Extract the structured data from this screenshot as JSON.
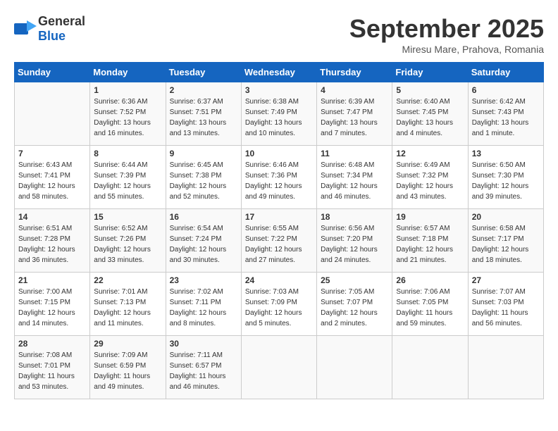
{
  "logo": {
    "general": "General",
    "blue": "Blue"
  },
  "title": "September 2025",
  "location": "Miresu Mare, Prahova, Romania",
  "days_of_week": [
    "Sunday",
    "Monday",
    "Tuesday",
    "Wednesday",
    "Thursday",
    "Friday",
    "Saturday"
  ],
  "weeks": [
    [
      {
        "day": "",
        "info": ""
      },
      {
        "day": "1",
        "info": "Sunrise: 6:36 AM\nSunset: 7:52 PM\nDaylight: 13 hours\nand 16 minutes."
      },
      {
        "day": "2",
        "info": "Sunrise: 6:37 AM\nSunset: 7:51 PM\nDaylight: 13 hours\nand 13 minutes."
      },
      {
        "day": "3",
        "info": "Sunrise: 6:38 AM\nSunset: 7:49 PM\nDaylight: 13 hours\nand 10 minutes."
      },
      {
        "day": "4",
        "info": "Sunrise: 6:39 AM\nSunset: 7:47 PM\nDaylight: 13 hours\nand 7 minutes."
      },
      {
        "day": "5",
        "info": "Sunrise: 6:40 AM\nSunset: 7:45 PM\nDaylight: 13 hours\nand 4 minutes."
      },
      {
        "day": "6",
        "info": "Sunrise: 6:42 AM\nSunset: 7:43 PM\nDaylight: 13 hours\nand 1 minute."
      }
    ],
    [
      {
        "day": "7",
        "info": "Sunrise: 6:43 AM\nSunset: 7:41 PM\nDaylight: 12 hours\nand 58 minutes."
      },
      {
        "day": "8",
        "info": "Sunrise: 6:44 AM\nSunset: 7:39 PM\nDaylight: 12 hours\nand 55 minutes."
      },
      {
        "day": "9",
        "info": "Sunrise: 6:45 AM\nSunset: 7:38 PM\nDaylight: 12 hours\nand 52 minutes."
      },
      {
        "day": "10",
        "info": "Sunrise: 6:46 AM\nSunset: 7:36 PM\nDaylight: 12 hours\nand 49 minutes."
      },
      {
        "day": "11",
        "info": "Sunrise: 6:48 AM\nSunset: 7:34 PM\nDaylight: 12 hours\nand 46 minutes."
      },
      {
        "day": "12",
        "info": "Sunrise: 6:49 AM\nSunset: 7:32 PM\nDaylight: 12 hours\nand 43 minutes."
      },
      {
        "day": "13",
        "info": "Sunrise: 6:50 AM\nSunset: 7:30 PM\nDaylight: 12 hours\nand 39 minutes."
      }
    ],
    [
      {
        "day": "14",
        "info": "Sunrise: 6:51 AM\nSunset: 7:28 PM\nDaylight: 12 hours\nand 36 minutes."
      },
      {
        "day": "15",
        "info": "Sunrise: 6:52 AM\nSunset: 7:26 PM\nDaylight: 12 hours\nand 33 minutes."
      },
      {
        "day": "16",
        "info": "Sunrise: 6:54 AM\nSunset: 7:24 PM\nDaylight: 12 hours\nand 30 minutes."
      },
      {
        "day": "17",
        "info": "Sunrise: 6:55 AM\nSunset: 7:22 PM\nDaylight: 12 hours\nand 27 minutes."
      },
      {
        "day": "18",
        "info": "Sunrise: 6:56 AM\nSunset: 7:20 PM\nDaylight: 12 hours\nand 24 minutes."
      },
      {
        "day": "19",
        "info": "Sunrise: 6:57 AM\nSunset: 7:18 PM\nDaylight: 12 hours\nand 21 minutes."
      },
      {
        "day": "20",
        "info": "Sunrise: 6:58 AM\nSunset: 7:17 PM\nDaylight: 12 hours\nand 18 minutes."
      }
    ],
    [
      {
        "day": "21",
        "info": "Sunrise: 7:00 AM\nSunset: 7:15 PM\nDaylight: 12 hours\nand 14 minutes."
      },
      {
        "day": "22",
        "info": "Sunrise: 7:01 AM\nSunset: 7:13 PM\nDaylight: 12 hours\nand 11 minutes."
      },
      {
        "day": "23",
        "info": "Sunrise: 7:02 AM\nSunset: 7:11 PM\nDaylight: 12 hours\nand 8 minutes."
      },
      {
        "day": "24",
        "info": "Sunrise: 7:03 AM\nSunset: 7:09 PM\nDaylight: 12 hours\nand 5 minutes."
      },
      {
        "day": "25",
        "info": "Sunrise: 7:05 AM\nSunset: 7:07 PM\nDaylight: 12 hours\nand 2 minutes."
      },
      {
        "day": "26",
        "info": "Sunrise: 7:06 AM\nSunset: 7:05 PM\nDaylight: 11 hours\nand 59 minutes."
      },
      {
        "day": "27",
        "info": "Sunrise: 7:07 AM\nSunset: 7:03 PM\nDaylight: 11 hours\nand 56 minutes."
      }
    ],
    [
      {
        "day": "28",
        "info": "Sunrise: 7:08 AM\nSunset: 7:01 PM\nDaylight: 11 hours\nand 53 minutes."
      },
      {
        "day": "29",
        "info": "Sunrise: 7:09 AM\nSunset: 6:59 PM\nDaylight: 11 hours\nand 49 minutes."
      },
      {
        "day": "30",
        "info": "Sunrise: 7:11 AM\nSunset: 6:57 PM\nDaylight: 11 hours\nand 46 minutes."
      },
      {
        "day": "",
        "info": ""
      },
      {
        "day": "",
        "info": ""
      },
      {
        "day": "",
        "info": ""
      },
      {
        "day": "",
        "info": ""
      }
    ]
  ]
}
